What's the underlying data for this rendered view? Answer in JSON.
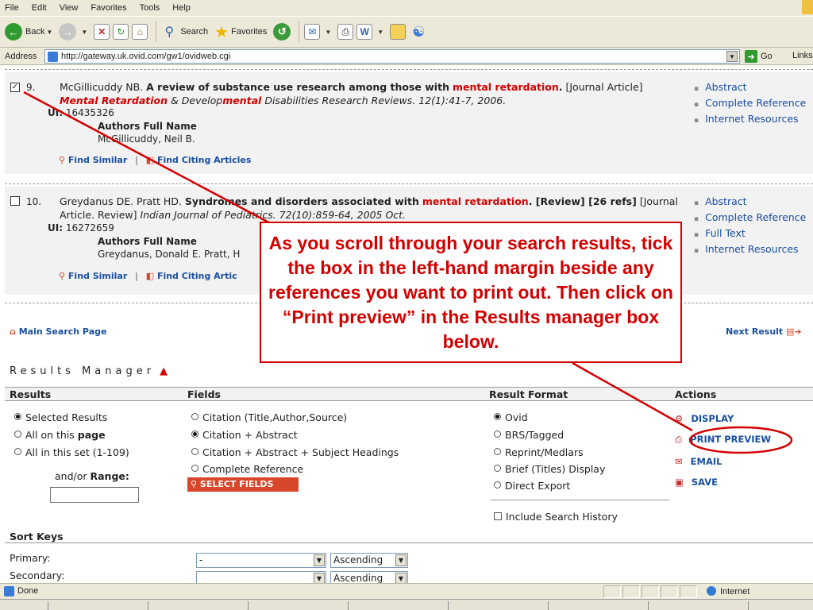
{
  "browser": {
    "menu": [
      "File",
      "Edit",
      "View",
      "Favorites",
      "Tools",
      "Help"
    ],
    "toolbar": {
      "back": "Back",
      "search": "Search",
      "favorites": "Favorites"
    },
    "address_label": "Address",
    "url": "http://gateway.uk.ovid.com/gw1/ovidweb.cgi",
    "go": "Go",
    "links": "Links"
  },
  "results": [
    {
      "number": "9.",
      "checked": true,
      "author": "McGillicuddy NB.",
      "title_a": "A review of substance use research among those with",
      "title_hl": "mental retardation",
      "title_b": ".",
      "type": "[Journal Article]",
      "journal_hl1": "Mental Retardation",
      "journal_mid": "& Develop",
      "journal_hl2": "mental",
      "journal_rest": "Disabilities Research Reviews. 12(1):41-7, 2006.",
      "ui_label": "UI:",
      "ui": "16435326",
      "authors_label": "Authors Full Name",
      "authors_full": "McGillicuddy, Neil B.",
      "find_similar": "Find Similar",
      "find_citing": "Find Citing Articles",
      "side_links": [
        "Abstract",
        "Complete Reference",
        "Internet Resources"
      ]
    },
    {
      "number": "10.",
      "checked": false,
      "author": "Greydanus DE. Pratt HD.",
      "title_a": "Syndromes and disorders associated with",
      "title_hl": "mental retardation",
      "title_b": ". [Review] [26 refs]",
      "type": "[Journal Article. Review]",
      "journal_rest": "Indian Journal of Pediatrics. 72(10):859-64, 2005 Oct.",
      "ui_label": "UI:",
      "ui": "16272659",
      "authors_label": "Authors Full Name",
      "authors_full": "Greydanus, Donald E. Pratt, H",
      "find_similar": "Find Similar",
      "find_citing": "Find Citing Artic",
      "side_links": [
        "Abstract",
        "Complete Reference",
        "Full Text",
        "Internet Resources"
      ]
    }
  ],
  "nav": {
    "main_search": "Main Search Page",
    "next_result": "Next Result"
  },
  "results_manager": {
    "title": "Results Manager",
    "columns": [
      "Results",
      "Fields",
      "Result Format",
      "Actions"
    ],
    "results_options": [
      {
        "label": "Selected Results",
        "selected": true
      },
      {
        "label": "All on this ",
        "bold": "page",
        "selected": false
      },
      {
        "label": "All in this set (1-109)",
        "selected": false
      }
    ],
    "range_label": "and/or ",
    "range_bold": "Range:",
    "fields_options": [
      {
        "label": "Citation (Title,Author,Source)",
        "selected": false
      },
      {
        "label": "Citation + Abstract",
        "selected": true
      },
      {
        "label": "Citation + Abstract + Subject Headings",
        "selected": false
      },
      {
        "label": "Complete Reference",
        "selected": false
      }
    ],
    "select_fields": "SELECT FIELDS",
    "format_options": [
      {
        "label": "Ovid",
        "selected": true
      },
      {
        "label": "BRS/Tagged",
        "selected": false
      },
      {
        "label": "Reprint/Medlars",
        "selected": false
      },
      {
        "label": "Brief (Titles) Display",
        "selected": false
      },
      {
        "label": "Direct Export",
        "selected": false
      }
    ],
    "include_history": "Include Search History",
    "actions": [
      "DISPLAY",
      "PRINT PREVIEW",
      "EMAIL",
      "SAVE"
    ]
  },
  "sort": {
    "title": "Sort Keys",
    "primary": "Primary:",
    "secondary": "Secondary:",
    "primary_value": "-",
    "order_value": "Ascending",
    "secondary_order": "Ascending"
  },
  "callout": {
    "text": "As you scroll through your search results, tick the box in the left-hand margin beside any references you want to print out.  Then click on “Print preview” in the Results manager box below."
  },
  "status": {
    "text": "Done",
    "zone": "Internet"
  },
  "colors": {
    "highlight": "#d40000",
    "link": "#1a4fa0",
    "annotation": "#d40000"
  }
}
